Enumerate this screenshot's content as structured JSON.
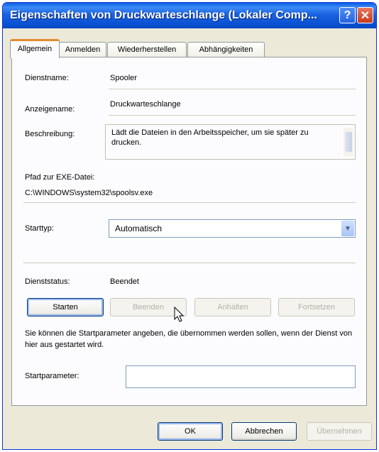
{
  "window": {
    "title": "Eigenschaften von Druckwarteschlange (Lokaler Comp...",
    "help_label": "?",
    "close_label": "✕"
  },
  "tabs": [
    {
      "label": "Allgemein",
      "active": true
    },
    {
      "label": "Anmelden",
      "active": false
    },
    {
      "label": "Wiederherstellen",
      "active": false
    },
    {
      "label": "Abhängigkeiten",
      "active": false
    }
  ],
  "general": {
    "service_name_label": "Dienstname:",
    "service_name_value": "Spooler",
    "display_name_label": "Anzeigename:",
    "display_name_value": "Druckwarteschlange",
    "description_label": "Beschreibung:",
    "description_value": "Lädt die Dateien in den Arbeitsspeicher, um sie später zu drucken.",
    "exe_path_label": "Pfad zur EXE-Datei:",
    "exe_path_value": "C:\\WINDOWS\\system32\\spoolsv.exe",
    "startup_type_label": "Starttyp:",
    "startup_type_value": "Automatisch",
    "service_status_label": "Dienststatus:",
    "service_status_value": "Beendet"
  },
  "service_buttons": {
    "start": "Starten",
    "stop": "Beenden",
    "pause": "Anhalten",
    "resume": "Fortsetzen"
  },
  "info_text": "Sie können die Startparameter angeben, die übernommen werden sollen, wenn der Dienst von hier aus gestartet wird.",
  "start_params": {
    "label": "Startparameter:",
    "value": ""
  },
  "dialog_buttons": {
    "ok": "OK",
    "cancel": "Abbrechen",
    "apply": "Übernehmen"
  },
  "colors": {
    "titlebar": "#0b53d4",
    "window_bg": "#ece9d8",
    "active_tab_accent": "#e68b2c"
  }
}
